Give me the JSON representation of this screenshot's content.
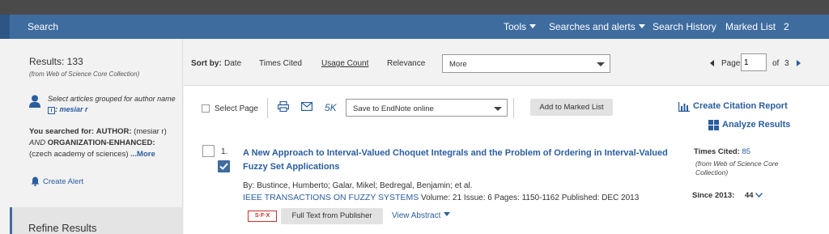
{
  "nav": {
    "search": "Search",
    "tools": "Tools",
    "searches_alerts": "Searches and alerts",
    "search_history": "Search History",
    "marked_list": "Marked List",
    "marked_count": "2"
  },
  "sidebar": {
    "results_title": "Results: 133",
    "results_sub": "(from Web of Science Core Collection)",
    "group_text": "Select articles grouped for author name",
    "group_author": "mesiar r",
    "searched_prefix": "You searched for:",
    "searched_author_label": "AUTHOR:",
    "searched_author_value": "(mesiar r)",
    "searched_and": "AND",
    "searched_org_label": "ORGANIZATION-ENHANCED:",
    "searched_org_value": "(czech academy of sciences)",
    "more": "...More",
    "create_alert": "Create Alert",
    "refine": "Refine Results"
  },
  "sort": {
    "label": "Sort by:",
    "options": [
      "Date",
      "Times Cited",
      "Usage Count",
      "Relevance"
    ],
    "more_value": "More",
    "page_label": "Page",
    "page_value": "1",
    "of_label": "of",
    "total_pages": "3"
  },
  "toolbar": {
    "select_page": "Select Page",
    "k_label": "5K",
    "save_value": "Save to EndNote online",
    "add_marked": "Add to Marked List",
    "create_citation": "Create Citation Report",
    "analyze": "Analyze Results"
  },
  "record": {
    "number": "1.",
    "title": "A New Approach to Interval-Valued Choquet Integrals and the Problem of Ordering in Interval-Valued Fuzzy Set Applications",
    "authors": "By: Bustince, Humberto; Galar, Mikel; Bedregal, Benjamin; et al.",
    "journal": "IEEE TRANSACTIONS ON FUZZY SYSTEMS",
    "volume": "Volume: 21",
    "issue": "Issue: 6",
    "pages": "Pages: 1150-1162",
    "published": "Published: DEC 2013",
    "sfx": "S·F·X",
    "full_text": "Full Text from Publisher",
    "view_abstract": "View Abstract",
    "times_cited_label": "Times Cited:",
    "times_cited_value": "85",
    "times_cited_sub": "(from Web of Science Core Collection)",
    "since_label": "Since 2013:",
    "since_value": "44"
  }
}
